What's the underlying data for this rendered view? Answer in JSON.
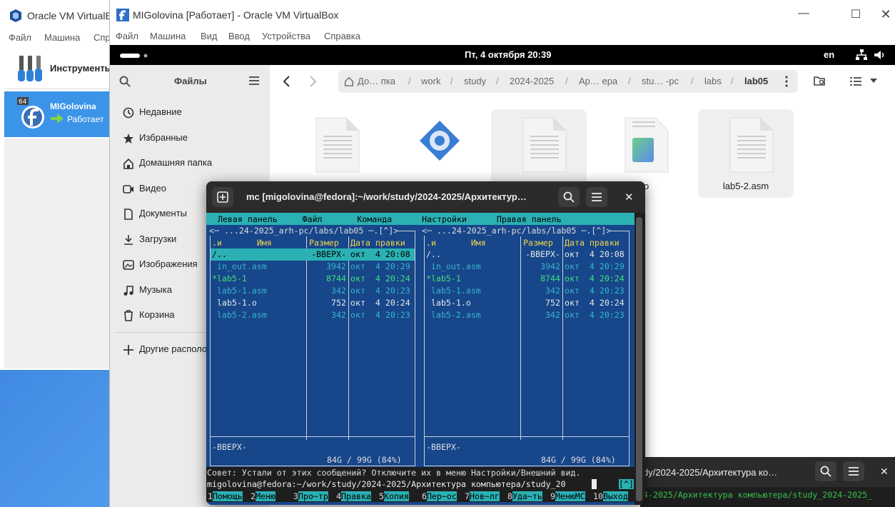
{
  "manager": {
    "title": "Oracle VM VirtualB",
    "menu": [
      "Файл",
      "Машина",
      "Спр"
    ],
    "tools_label": "Инструменты",
    "vm_name": "MIGolovina",
    "vm_status": "Работает",
    "vm_badge": "64"
  },
  "vm_window": {
    "title": "MIGolovina [Работает] - Oracle VM VirtualBox",
    "menu": [
      "Файл",
      "Машина",
      "Вид",
      "Ввод",
      "Устройства",
      "Справка"
    ]
  },
  "gnome": {
    "clock": "Пт, 4 октября  20:39",
    "lang": "en"
  },
  "files": {
    "title": "Файлы",
    "sidebar": [
      "Недавние",
      "Избранные",
      "Домашняя папка",
      "Видео",
      "Документы",
      "Загрузки",
      "Изображения",
      "Музыка",
      "Корзина",
      "Другие располо"
    ],
    "breadcrumbs": [
      "До… пка",
      "work",
      "study",
      "2024-2025",
      "Ар… ера",
      "stu… -pc",
      "labs",
      "lab05"
    ],
    "items": [
      "",
      "",
      "",
      "-1.o",
      "lab5-2.asm"
    ]
  },
  "terminal": {
    "title": "mc [migolovina@fedora]:~/work/study/2024-2025/Архитектур…",
    "menubar": "  Левая панель     Файл       Команда      Настройки      Правая панель",
    "left_header": "<─ ...24-2025_arh-pc/labs/lab05 ─.[^]>",
    "right_header": "<─ ...24-2025_arh-pc/labs/lab05 ─.[^]>",
    "col_name": ".и       Имя",
    "col_size": "Размер",
    "col_date": "Дата правки",
    "rows": [
      {
        "name": "/..",
        "size": "-ВВЕРХ-",
        "date": "окт  4 20:08",
        "kind": "up"
      },
      {
        "name": " in_out.asm",
        "size": "3942",
        "date": "окт  4 20:29",
        "kind": "src"
      },
      {
        "name": "*lab5-1",
        "size": "8744",
        "date": "окт  4 20:24",
        "kind": "exe"
      },
      {
        "name": " lab5-1.asm",
        "size": "342",
        "date": "окт  4 20:23",
        "kind": "src"
      },
      {
        "name": " lab5-1.o",
        "size": "752",
        "date": "окт  4 20:24",
        "kind": "obj"
      },
      {
        "name": " lab5-2.asm",
        "size": "342",
        "date": "окт  4 20:23",
        "kind": "src"
      }
    ],
    "mini_status": "-ВВЕРХ-",
    "disk": " 84G / 99G (84%) ",
    "hint": "Совет: Устали от этих сообщений? Отключите их в меню Настройки/Внешний вид.",
    "cmdline": "migolovina@fedora:~/work/study/2024-2025/Архитектура компьютера/study_20",
    "cmd_flag": "[^]",
    "fkeys": [
      {
        "n": "1",
        "l": "Помощь"
      },
      {
        "n": "2",
        "l": "Меню"
      },
      {
        "n": "3",
        "l": "Про~тр"
      },
      {
        "n": "4",
        "l": "Правка"
      },
      {
        "n": "5",
        "l": "Копия"
      },
      {
        "n": "6",
        "l": "Пер~ос"
      },
      {
        "n": "7",
        "l": "Нов~лг"
      },
      {
        "n": "8",
        "l": "Уда~ть"
      },
      {
        "n": "9",
        "l": "МенюMC"
      },
      {
        "n": "10",
        "l": "Выход"
      }
    ]
  },
  "terminal2": {
    "title": "dy/2024-2025/Архитектура ко…",
    "line": "4-2025/Архитектура компьютера/study_2024-2025_"
  },
  "colors": {
    "mc_bg": "#17468a",
    "mc_accent": "#2bb0b3",
    "selection": "#3b94e8"
  }
}
